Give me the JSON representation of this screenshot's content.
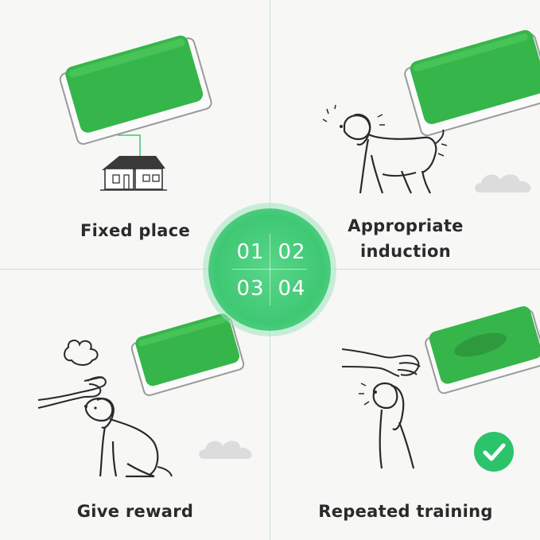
{
  "steps": [
    {
      "number": "01",
      "label": "Fixed place"
    },
    {
      "number": "02",
      "label_line1": "Appropriate",
      "label_line2": "induction"
    },
    {
      "number": "03",
      "label": "Give reward"
    },
    {
      "number": "04",
      "label": "Repeated training"
    }
  ],
  "icons": [
    "grass-pad-icon",
    "house-icon",
    "dog-icon",
    "hand-icon",
    "cloud-icon",
    "checkmark-icon"
  ],
  "colors": {
    "grass": "#36b54a",
    "badge": "#3fc874",
    "check": "#2bc46b",
    "text": "#2a2a2a",
    "background": "#f7f7f6"
  }
}
